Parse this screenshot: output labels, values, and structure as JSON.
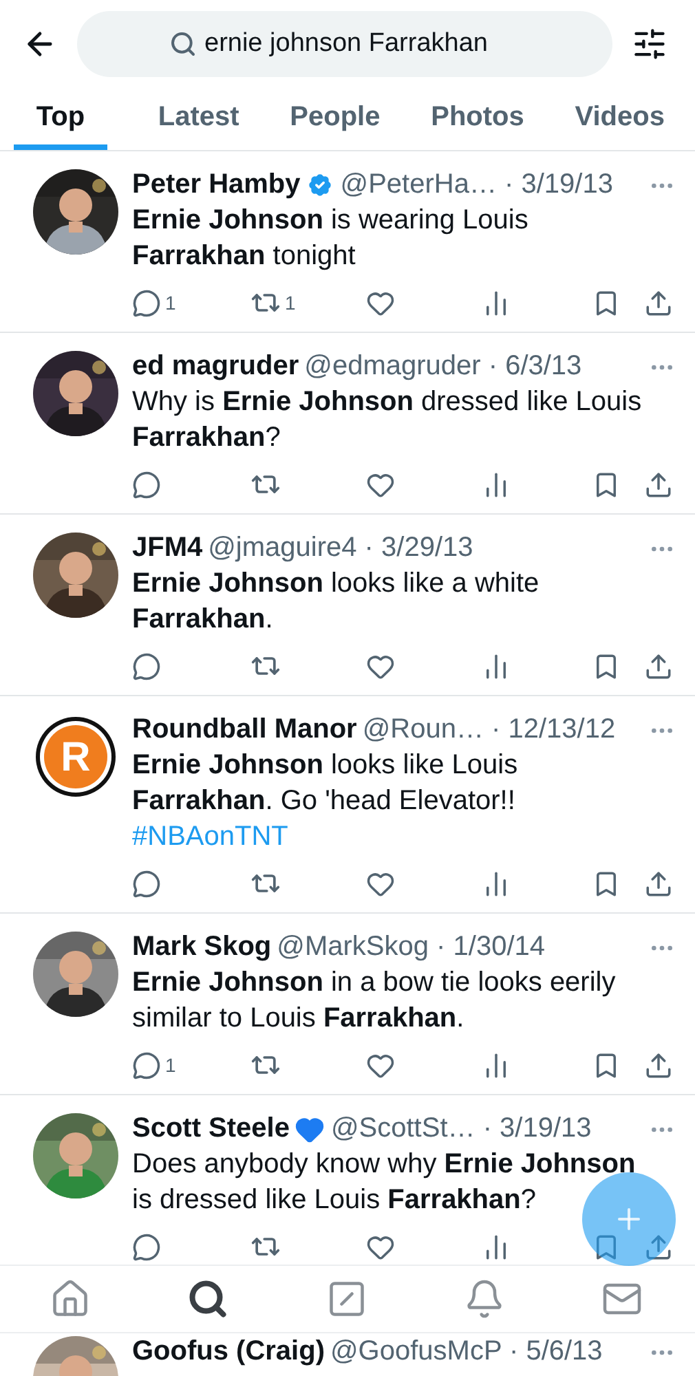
{
  "search": {
    "query": "ernie johnson Farrakhan"
  },
  "tabs": [
    {
      "label": "Top",
      "selected": true
    },
    {
      "label": "Latest",
      "selected": false
    },
    {
      "label": "People",
      "selected": false
    },
    {
      "label": "Photos",
      "selected": false
    },
    {
      "label": "Videos",
      "selected": false
    }
  ],
  "tweets": [
    {
      "kind": "full",
      "name": "Peter Hamby",
      "verified": true,
      "meta": "@PeterHa… · 3/19/13",
      "text": "**Ernie Johnson** is wearing Louis **Farrakhan** tonight",
      "replies": "1",
      "reposts": "1"
    },
    {
      "kind": "full",
      "name": "ed magruder",
      "meta": "@edmagruder · 6/3/13",
      "text": "Why is **Ernie Johnson** dressed like Louis **Farrakhan**?"
    },
    {
      "kind": "full",
      "name": "JFM4",
      "meta": "@jmaguire4 · 3/29/13",
      "text": "**Ernie Johnson** looks like a white **Farrakhan**."
    },
    {
      "kind": "full",
      "avatar": {
        "kind": "logo",
        "letter": "R"
      },
      "name": "Roundball Manor",
      "meta": "@Roun… · 12/13/12",
      "text": "**Ernie Johnson** looks like Louis **Farrakhan**. Go 'head Elevator!!",
      "hashtag": "#NBAonTNT"
    },
    {
      "kind": "full",
      "name": "Mark Skog",
      "meta": "@MarkSkog · 1/30/14",
      "text": "**Ernie Johnson** in a bow tie looks eerily similar to Louis **Farrakhan**.",
      "replies": "1"
    },
    {
      "kind": "full",
      "name": "Scott Steele",
      "heart": true,
      "meta": "@ScottSt… · 3/19/13",
      "text": "Does anybody know why **Ernie Johnson** is dressed like Louis **Farrakhan**?"
    },
    {
      "kind": "partial",
      "name": "Goofus (Craig)",
      "meta": "@GoofusMcP · 5/6/13"
    }
  ],
  "nav": [
    {
      "kind": "home",
      "selected": false
    },
    {
      "kind": "search",
      "selected": true
    },
    {
      "kind": "compose",
      "selected": false
    },
    {
      "kind": "bell",
      "selected": false
    },
    {
      "kind": "mail",
      "selected": false
    }
  ]
}
